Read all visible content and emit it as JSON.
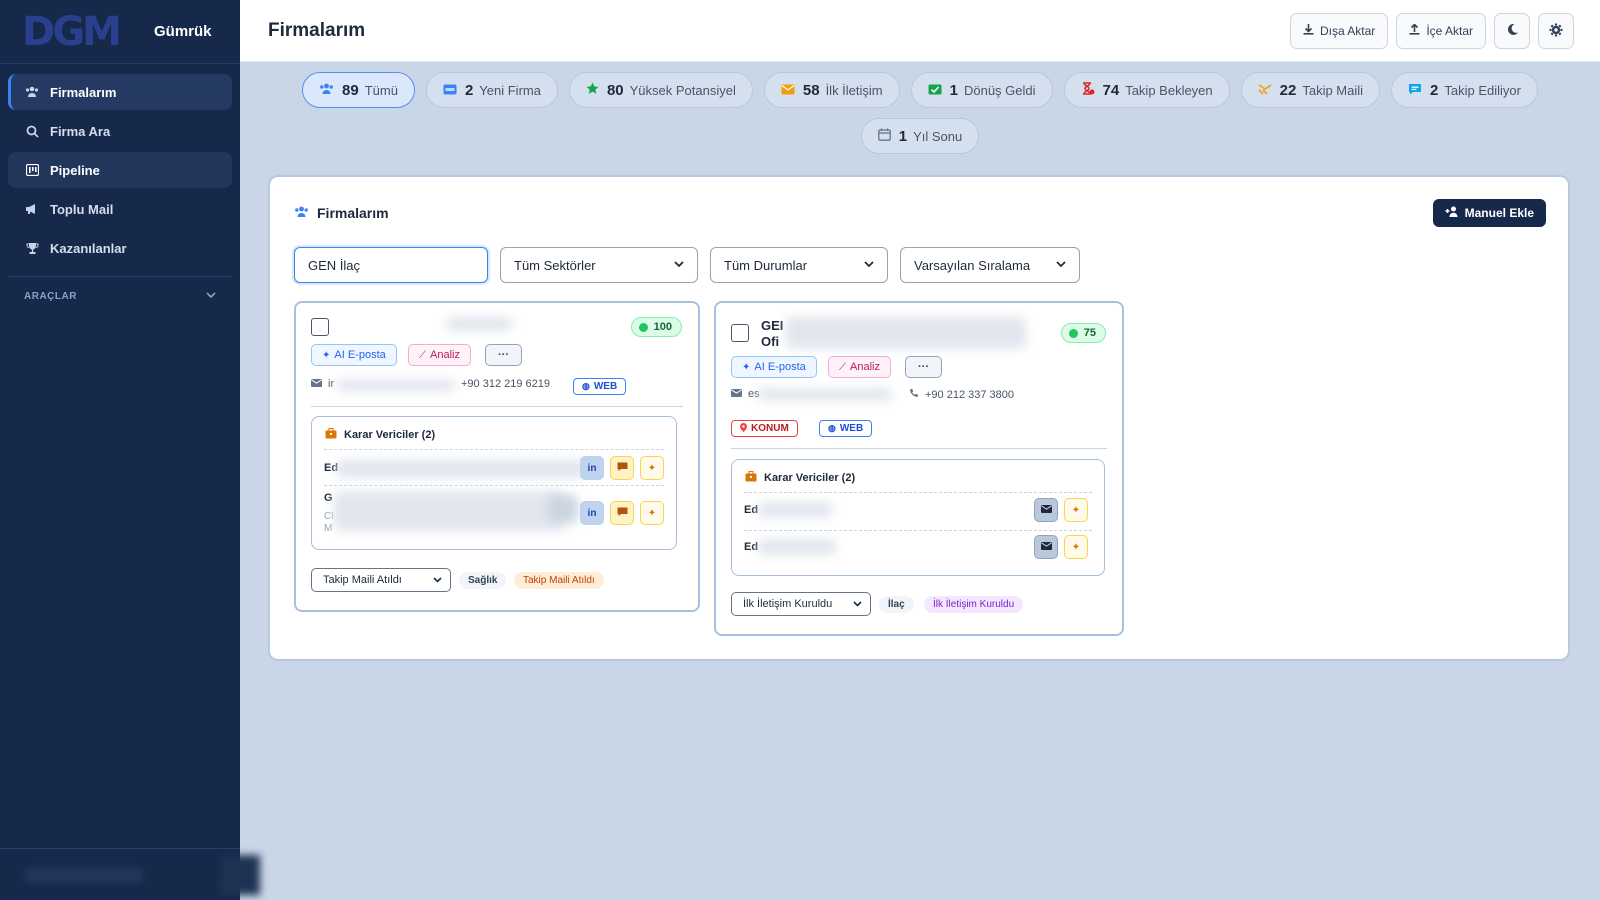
{
  "sidebar": {
    "logo_text": "DGM",
    "brand": "Gümrük",
    "items": [
      {
        "label": "Firmalarım",
        "icon": "users-icon"
      },
      {
        "label": "Firma Ara",
        "icon": "search-icon"
      },
      {
        "label": "Pipeline",
        "icon": "pipeline-icon"
      },
      {
        "label": "Toplu Mail",
        "icon": "megaphone-icon"
      },
      {
        "label": "Kazanılanlar",
        "icon": "trophy-icon"
      }
    ],
    "section": "ARAÇLAR"
  },
  "header": {
    "title": "Firmalarım",
    "export_label": "Dışa Aktar",
    "import_label": "İçe Aktar"
  },
  "chips": [
    {
      "count": "89",
      "label": "Tümü",
      "icon": "users-icon",
      "color": "#3b82f6"
    },
    {
      "count": "2",
      "label": "Yeni Firma",
      "icon": "new-badge-icon",
      "color": "#3b82f6"
    },
    {
      "count": "80",
      "label": "Yüksek Potansiyel",
      "icon": "star-icon",
      "color": "#16a34a"
    },
    {
      "count": "58",
      "label": "İlk İletişim",
      "icon": "envelope-icon",
      "color": "#f59e0b"
    },
    {
      "count": "1",
      "label": "Dönüş Geldi",
      "icon": "reply-icon",
      "color": "#16a34a"
    },
    {
      "count": "74",
      "label": "Takip Bekleyen",
      "icon": "hourglass-icon",
      "color": "#dc2626"
    },
    {
      "count": "22",
      "label": "Takip Maili",
      "icon": "forward-mail-icon",
      "color": "#f59e0b"
    },
    {
      "count": "2",
      "label": "Takip Ediliyor",
      "icon": "chat-icon",
      "color": "#0ea5e9"
    },
    {
      "count": "1",
      "label": "Yıl Sonu",
      "icon": "calendar-icon",
      "color": "#64748b"
    }
  ],
  "panel": {
    "title": "Firmalarım",
    "add_label": "Manuel Ekle",
    "search_value": "GEN İlaç",
    "sector_select": "Tüm Sektörler",
    "status_select": "Tüm Durumlar",
    "sort_select": "Varsayılan Sıralama"
  },
  "cards": [
    {
      "score": "100",
      "name": "",
      "ai_label": "AI E-posta",
      "analysis_label": "Analiz",
      "more_label": "···",
      "email_prefix": "ir",
      "phone": "+90 312 219 6219",
      "web_tag": "WEB",
      "dm_title": "Karar Vericiler (2)",
      "dm": [
        {
          "name": "Ed",
          "linkedin": "in"
        },
        {
          "name": "G",
          "sub": "Cl",
          "sub2": "M",
          "linkedin": "in"
        }
      ],
      "status_select": "Takip Maili Atıldı",
      "sector_pill": "Sağlık",
      "status_pill": "Takip Maili Atıldı"
    },
    {
      "score": "75",
      "name_line1": "GEI",
      "name_line2": "Ofi",
      "ai_label": "AI E-posta",
      "analysis_label": "Analiz",
      "more_label": "···",
      "email_prefix": "es",
      "phone": "+90 212 337 3800",
      "location_tag": "KONUM",
      "web_tag": "WEB",
      "dm_title": "Karar Vericiler (2)",
      "dm": [
        {
          "name": "Ed"
        },
        {
          "name": "Ed"
        }
      ],
      "status_select": "İlk İletişim Kuruldu",
      "sector_pill": "İlaç",
      "status_pill": "İlk İletişim Kuruldu"
    }
  ]
}
